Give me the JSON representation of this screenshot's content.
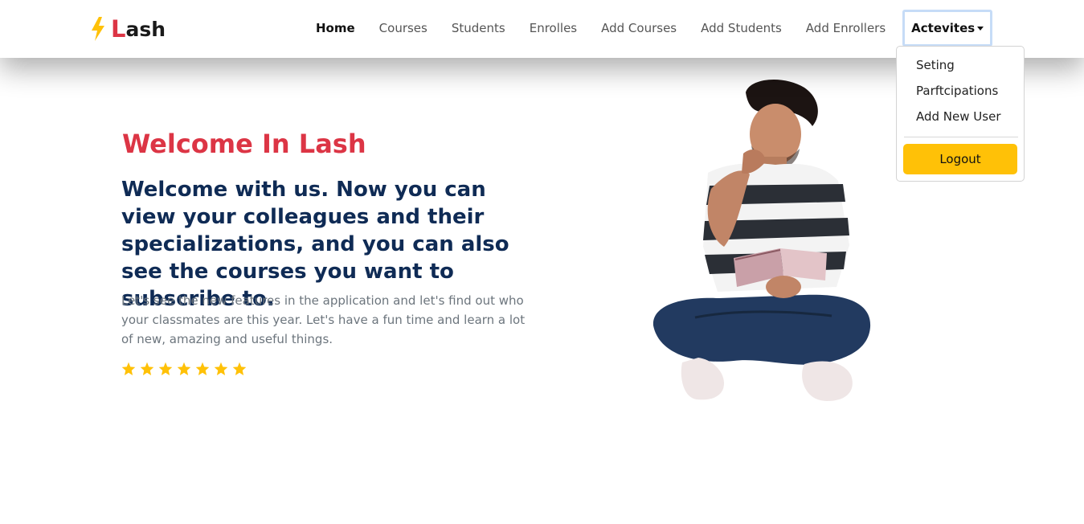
{
  "brand": {
    "first_letter": "L",
    "rest": "ash",
    "icon": "lightning-bolt-icon",
    "accent": "#dc3545",
    "bolt_color": "#ffc107"
  },
  "nav": {
    "items": [
      {
        "label": "Home",
        "active": true
      },
      {
        "label": "Courses"
      },
      {
        "label": "Students"
      },
      {
        "label": "Enrolles"
      },
      {
        "label": "Add Courses"
      },
      {
        "label": "Add Students"
      },
      {
        "label": "Add Enrollers"
      }
    ],
    "dropdown_label": "Actevites"
  },
  "dropdown": {
    "items": [
      "Seting",
      "Parftcipations",
      "Add New User"
    ],
    "logout_label": "Logout",
    "logout_color": "#ffc107"
  },
  "hero": {
    "title": "Welcome In Lash",
    "lead": "Welcome with us. Now you can view your colleagues and their specializations, and you can also see the courses you want to subscribe to.",
    "text": "Let's see the new features in the application and let's find out who your classmates are this year. Let's have a fun time and learn a lot of new, amazing and useful things.",
    "rating": 7,
    "star_color": "#ffc107"
  },
  "illustration": {
    "icon": "student-with-book-photo"
  }
}
